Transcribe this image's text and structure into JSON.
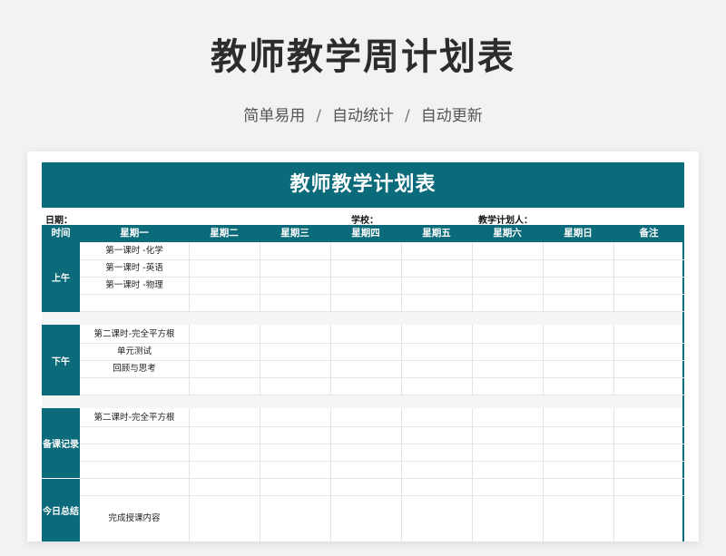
{
  "hero": {
    "title": "教师教学周计划表",
    "features": [
      "简单易用",
      "自动统计",
      "自动更新"
    ],
    "separator": "/"
  },
  "sheet": {
    "title": "教师教学计划表",
    "info": {
      "date_label": "日期：",
      "school_label": "学校：",
      "planner_label": "教学计划人："
    },
    "headers": [
      "时间",
      "星期一",
      "星期二",
      "星期三",
      "星期四",
      "星期五",
      "星期六",
      "星期日",
      "备注"
    ],
    "sections": [
      {
        "name": "上午",
        "monday": [
          "第一课时 -化学",
          "第一课时 -英语",
          "第一课时 -物理",
          ""
        ]
      },
      {
        "name": "下午",
        "monday": [
          "第二课时-完全平方根",
          "单元测试",
          "回顾与思考",
          ""
        ]
      },
      {
        "name": "备课记录",
        "monday": [
          "第二课时-完全平方根",
          "",
          "",
          ""
        ]
      },
      {
        "name": "今日总结",
        "monday": [
          "完成授课内容"
        ]
      }
    ]
  },
  "colors": {
    "accent": "#0c6b7a",
    "page_bg": "#f1f2f4",
    "title_text": "#2c2c2c"
  }
}
